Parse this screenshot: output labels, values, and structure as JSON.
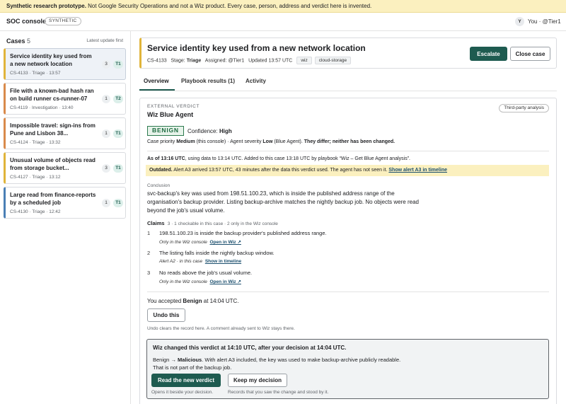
{
  "banner": {
    "bold": "Synthetic research prototype.",
    "text": " Not Google Security Operations and not a Wiz product. Every case, person, address and verdict here is invented."
  },
  "app": {
    "title": "SOC console",
    "env_badge": "SYNTHETIC",
    "user_initial": "Y",
    "user_label": "You · @Tier1"
  },
  "sidebar": {
    "title": "Cases",
    "count": "5",
    "sort_label": "Latest update first",
    "cases": [
      {
        "title": "Service identity key used from a new network location",
        "meta": "CS-4133 · Triage · 13:57",
        "count": "3",
        "tier": "T1",
        "accent": "#e0b43a"
      },
      {
        "title": "File with a known-bad hash ran on build runner cs-runner-07",
        "meta": "CS-4119 · Investigation · 13:40",
        "count": "1",
        "tier": "T2",
        "accent": "#d98a4b"
      },
      {
        "title": "Impossible travel: sign-ins from Pune and Lisbon 38...",
        "meta": "CS-4124 · Triage · 13:32",
        "count": "1",
        "tier": "T1",
        "accent": "#d98a4b"
      },
      {
        "title": "Unusual volume of objects read from storage bucket...",
        "meta": "CS-4127 · Triage · 13:12",
        "count": "3",
        "tier": "T1",
        "accent": "#e0b43a"
      },
      {
        "title": "Large read from finance-reports by a scheduled job",
        "meta": "CS-4130 · Triage · 12:42",
        "count": "1",
        "tier": "T1",
        "accent": "#4a7fb5"
      }
    ]
  },
  "case": {
    "title": "Service identity key used from a new network location",
    "id": "CS-4133",
    "stage_label": "Stage:",
    "stage": "Triage",
    "assigned": "Assigned: @Tier1",
    "updated": "Updated 13:57 UTC",
    "tags": [
      "wiz",
      "cloud-storage"
    ],
    "escalate_label": "Escalate",
    "close_label": "Close case"
  },
  "tabs": [
    "Overview",
    "Playbook results (1)",
    "Activity"
  ],
  "verdict": {
    "kicker": "EXTERNAL VERDICT",
    "agent": "Wiz Blue Agent",
    "third_party": "Third-party analysis",
    "verdict": "BENIGN",
    "confidence_label": "Confidence:",
    "confidence": "High",
    "priority_pre": "Case priority ",
    "priority_case": "Medium",
    "priority_mid": " (this console) · Agent severity ",
    "priority_agent": "Low",
    "priority_post": " (Blue Agent). ",
    "priority_note": "They differ; neither has been changed.",
    "asof_bold": "As of 13:16 UTC",
    "asof_text": ", using data to 13:14 UTC. Added to this case 13:18 UTC by playbook “Wiz – Get Blue Agent analysis”.",
    "outdated_bold": "Outdated.",
    "outdated_text": " Alert A3 arrived 13:57 UTC, 43 minutes after the data this verdict used. The agent has not seen it. ",
    "outdated_link": "Show alert A3 in timeline",
    "conclusion_label": "Conclusion",
    "conclusion": "svc-backup's key was used from 198.51.100.23, which is inside the published address range of the organisation's backup provider. Listing backup-archive matches the nightly backup job. No objects were read beyond the job's usual volume.",
    "claims_label": "Claims",
    "claims_count": "3 · 1 checkable in this case · 2 only in the Wiz console",
    "claims": [
      {
        "num": "1",
        "text": "198.51.100.23 is inside the backup provider's published address range.",
        "sub": "Only in the Wiz console",
        "link": "Open in Wiz ↗"
      },
      {
        "num": "2",
        "text": "The listing falls inside the nightly backup window.",
        "sub": "Alert A2 · in this case",
        "link": "Show in timeline"
      },
      {
        "num": "3",
        "text": "No reads above the job's usual volume.",
        "sub": "Only in the Wiz console",
        "link": "Open in Wiz ↗"
      }
    ],
    "accepted_pre": "You accepted ",
    "accepted_verdict": "Benign",
    "accepted_post": " at 14:04 UTC.",
    "undo_label": "Undo this",
    "undo_hint": "Undo clears the record here. A comment already sent to Wiz stays there."
  },
  "change": {
    "title": "Wiz changed this verdict at 14:10 UTC, after your decision at 14:04 UTC.",
    "from": "Benign",
    "arrow": " → ",
    "to": "Malicious",
    "body": ". With alert A3 included, the key was used to make backup-archive publicly readable. That is not part of the backup job.",
    "read_label": "Read the new verdict",
    "read_hint": "Opens it beside your decision.",
    "keep_label": "Keep my decision",
    "keep_hint": "Records that you saw the change and stood by it."
  }
}
